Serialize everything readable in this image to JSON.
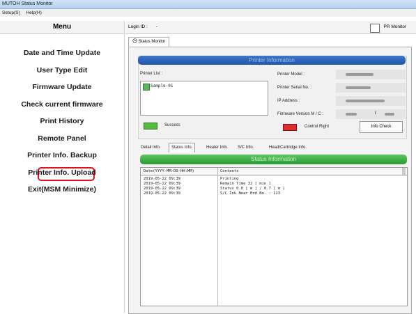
{
  "window": {
    "title": "MUTOH Status Monitor"
  },
  "menubar": {
    "items": [
      "Setup(S)",
      "Help(H)"
    ]
  },
  "sidebar": {
    "heading": "Menu",
    "items": [
      {
        "label": "Date and Time Update"
      },
      {
        "label": "User Type Edit"
      },
      {
        "label": "Firmware Update"
      },
      {
        "label": "Check current firmware"
      },
      {
        "label": "Print History"
      },
      {
        "label": "Remote Panel"
      },
      {
        "label": "Printer Info. Backup"
      },
      {
        "label": "Printer Info. Upload"
      },
      {
        "label": "Exit(MSM Minimize)"
      }
    ],
    "highlighted": "Remote Panel",
    "highlight_color": "#e0101f"
  },
  "topbar": {
    "login_label": "Login ID :",
    "login_value": "-",
    "pr_monitor_label": "PR Monitor"
  },
  "main_tab": {
    "icon": "clock-icon",
    "label": "Status Monitor"
  },
  "printer_info": {
    "header": "Printer Information",
    "list_label": "Printer List :",
    "list_items": [
      "Sample-01"
    ],
    "status_text": "Success",
    "fields": [
      "Printer Model :",
      "Printer Serial No. :",
      "IP Address :",
      "Firmware Version M / C :"
    ],
    "firmware_separator": "/",
    "control_right_label": "Control Right",
    "info_check_button": "Info Check"
  },
  "subtabs": {
    "items": [
      "Detail Info.",
      "Status Info.",
      "Heater Info.",
      "S/C Info.",
      "Head/Cartridge Info."
    ],
    "active": "Status Info."
  },
  "status_info": {
    "header": "Status Information",
    "columns": [
      "Date(YYYY-MM-DD-HH:MM)",
      "Contents"
    ],
    "rows": [
      {
        "date": "2019-05-22 09:39",
        "content": "Printing"
      },
      {
        "date": "2019-05-22 09:39",
        "content": "Remain Time 32 [ min ]"
      },
      {
        "date": "2019-05-22 09:39",
        "content": "Status 0.0 [ m ] / 0.7 [ m ]"
      },
      {
        "date": "2019-05-22 09:39",
        "content": "S/C Ink Near End No. : 123"
      }
    ]
  },
  "colors": {
    "accent_blue": "#1f55aa",
    "accent_green": "#2c9a3a",
    "success_green": "#55b93e",
    "control_red": "#d63030"
  }
}
